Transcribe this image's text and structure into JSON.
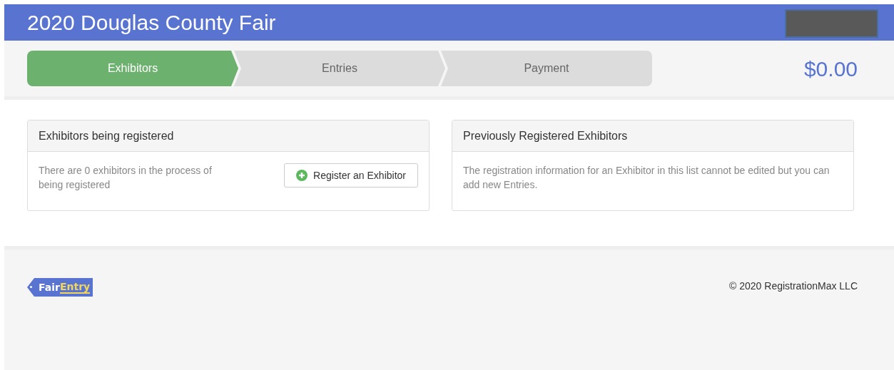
{
  "header": {
    "title": "2020 Douglas County Fair"
  },
  "steps": [
    {
      "label": "Exhibitors",
      "selected": true
    },
    {
      "label": "Entries",
      "selected": false
    },
    {
      "label": "Payment",
      "selected": false
    }
  ],
  "total": "$0.00",
  "panels": [
    {
      "title": "Exhibitors being registered",
      "text": "There are 0 exhibitors in the process of being registered",
      "button": "Register an Exhibitor"
    },
    {
      "title": "Previously Registered Exhibitors",
      "text": "The registration information for an Exhibitor in this list cannot be edited but you can add new Entries."
    }
  ],
  "footer": {
    "logo": [
      "Fair",
      "Entry"
    ],
    "copyright": "© 2020 RegistrationMax LLC"
  }
}
